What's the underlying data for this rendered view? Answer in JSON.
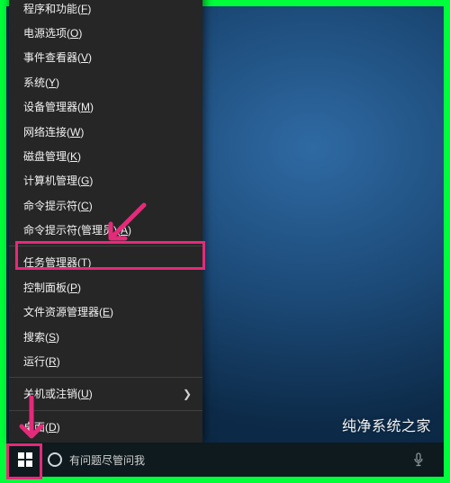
{
  "watermark": "纯净系统之家",
  "search": {
    "placeholder": "有问题尽管问我"
  },
  "menu": {
    "programs": {
      "text": "程序和功能",
      "accel": "F"
    },
    "power_opts": {
      "text": "电源选项",
      "accel": "O"
    },
    "event_viewer": {
      "text": "事件查看器",
      "accel": "V"
    },
    "system": {
      "text": "系统",
      "accel": "Y"
    },
    "dev_mgr": {
      "text": "设备管理器",
      "accel": "M"
    },
    "net_conn": {
      "text": "网络连接",
      "accel": "W"
    },
    "disk_mgmt": {
      "text": "磁盘管理",
      "accel": "K"
    },
    "comp_mgmt": {
      "text": "计算机管理",
      "accel": "G"
    },
    "cmd": {
      "text": "命令提示符",
      "accel": "C"
    },
    "cmd_admin": {
      "text": "命令提示符(管理员)",
      "accel": "A"
    },
    "task_mgr": {
      "text": "任务管理器",
      "accel": "T"
    },
    "ctrl_panel": {
      "text": "控制面板",
      "accel": "P"
    },
    "file_explorer": {
      "text": "文件资源管理器",
      "accel": "E"
    },
    "search": {
      "text": "搜索",
      "accel": "S"
    },
    "run": {
      "text": "运行",
      "accel": "R"
    },
    "shutdown": {
      "text": "关机或注销",
      "accel": "U"
    },
    "desktop": {
      "text": "桌面",
      "accel": "D"
    }
  },
  "annotation": {
    "highlight_item": "cmd_admin",
    "highlight_button": "start-button",
    "color": "#e52a7a"
  }
}
